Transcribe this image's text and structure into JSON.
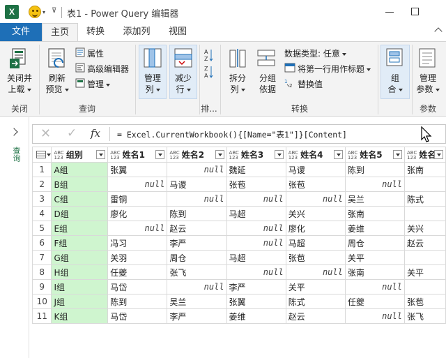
{
  "window": {
    "app_icon": "X",
    "title": "表1 - Power Query 编辑器"
  },
  "tabs": [
    {
      "label": "文件"
    },
    {
      "label": "主页"
    },
    {
      "label": "转换"
    },
    {
      "label": "添加列"
    },
    {
      "label": "视图"
    }
  ],
  "ribbon": {
    "close": {
      "btn_line1": "关闭并",
      "btn_line2": "上载",
      "group": "关闭"
    },
    "query": {
      "refresh_line1": "刷新",
      "refresh_line2": "预览",
      "properties": "属性",
      "advanced_editor": "高级编辑器",
      "manage": "管理",
      "group": "查询"
    },
    "columns": {
      "manage_line1": "管理",
      "manage_line2": "列"
    },
    "rows": {
      "reduce_line1": "减少",
      "reduce_line2": "行"
    },
    "sort": {
      "group": "排..."
    },
    "transform": {
      "split_line1": "拆分",
      "split_line2": "列",
      "groupby_line1": "分组",
      "groupby_line2": "依据",
      "data_type": "数据类型: 任意",
      "first_row_header": "将第一行用作标题",
      "replace_values": "替换值",
      "group": "转换"
    },
    "combine": {
      "line1": "组",
      "line2": "合"
    },
    "params": {
      "line1": "管理",
      "line2": "参数",
      "group": "参数"
    }
  },
  "nav": {
    "label": "查询"
  },
  "formula": {
    "fx": "fx",
    "text": "= Excel.CurrentWorkbook(){[Name=\"表1\"]}[Content]"
  },
  "grid": {
    "type_label_top": "ABC",
    "type_label_bottom": "123",
    "headers": [
      "组别",
      "姓名1",
      "姓名2",
      "姓名3",
      "姓名4",
      "姓名5",
      "姓名"
    ],
    "rows": [
      [
        "1",
        "A组",
        "张翼",
        "null",
        "魏延",
        "马谡",
        "陈到",
        "张南"
      ],
      [
        "2",
        "B组",
        "null",
        "马谡",
        "张苞",
        "张苞",
        "null",
        ""
      ],
      [
        "3",
        "C组",
        "雷铜",
        "null",
        "null",
        "null",
        "吴兰",
        "陈式"
      ],
      [
        "4",
        "D组",
        "廖化",
        "陈到",
        "马超",
        "关兴",
        "张南",
        ""
      ],
      [
        "5",
        "E组",
        "null",
        "赵云",
        "null",
        "廖化",
        "姜维",
        "关兴"
      ],
      [
        "6",
        "F组",
        "冯习",
        "李严",
        "null",
        "马超",
        "周仓",
        "赵云"
      ],
      [
        "7",
        "G组",
        "关羽",
        "周仓",
        "马超",
        "张苞",
        "关平",
        ""
      ],
      [
        "8",
        "H组",
        "任夔",
        "张飞",
        "null",
        "null",
        "张南",
        "关平"
      ],
      [
        "9",
        "I组",
        "马岱",
        "null",
        "李严",
        "关平",
        "null",
        ""
      ],
      [
        "10",
        "J组",
        "陈到",
        "吴兰",
        "张翼",
        "陈式",
        "任夔",
        "张苞"
      ],
      [
        "11",
        "K组",
        "马岱",
        "李严",
        "姜维",
        "赵云",
        "null",
        "张飞"
      ]
    ]
  }
}
